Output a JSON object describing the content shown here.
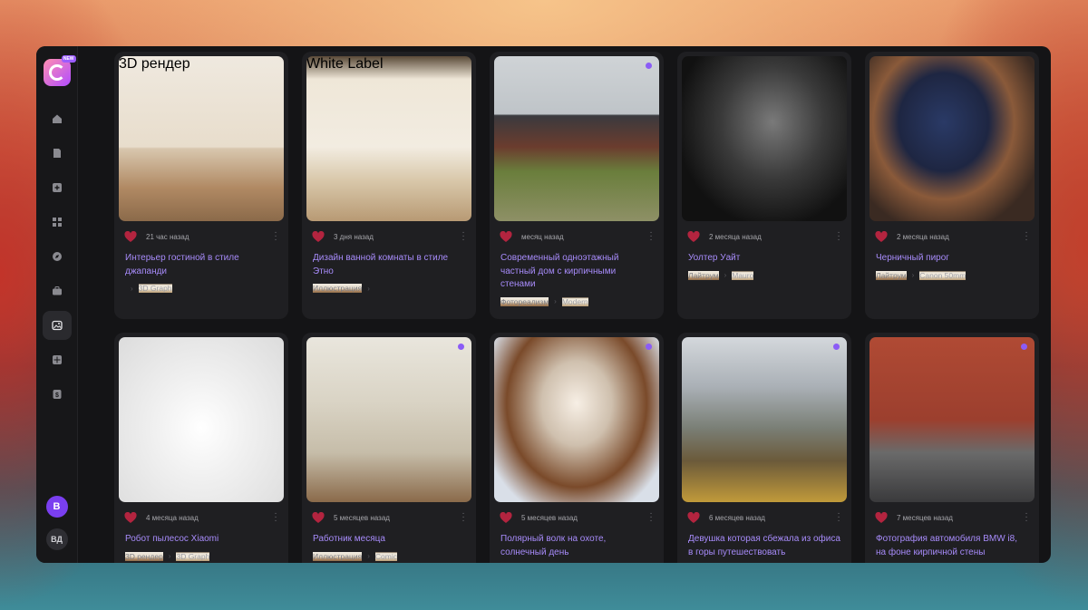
{
  "sidebar": {
    "logo_badge": "NEW",
    "nav": [
      {
        "icon": "home-icon",
        "active": false
      },
      {
        "icon": "document-icon",
        "active": false
      },
      {
        "icon": "plus-square-icon",
        "active": false
      },
      {
        "icon": "grid-icon",
        "active": false
      },
      {
        "icon": "compass-icon",
        "active": false
      },
      {
        "icon": "briefcase-icon",
        "active": false
      },
      {
        "icon": "image-gallery-icon",
        "active": true
      },
      {
        "icon": "apps-icon",
        "active": false
      },
      {
        "icon": "dollar-icon",
        "active": false
      }
    ],
    "avatar_primary": "B",
    "avatar_secondary": "ВД"
  },
  "cards": [
    {
      "time": "21 час назад",
      "title": "Интерьер гостиной в стиле джапанди",
      "tag1": "3D рендер",
      "tag2": "3D Graph",
      "dot": false
    },
    {
      "time": "3 дня назад",
      "title": "Дизайн ванной комнаты в стиле Этно",
      "tag1": "Иллюстрация",
      "tag2": "White Label",
      "dot": false
    },
    {
      "time": "месяц назад",
      "title": "Современный одноэтажный частный дом с кирпичными стенами",
      "tag1": "Фотореализм",
      "tag2": "Modern",
      "dot": true
    },
    {
      "time": "2 месяца назад",
      "title": "Уолтер Уайт",
      "tag1": "Лайтрум",
      "tag2": "Mauro",
      "dot": false
    },
    {
      "time": "2 месяца назад",
      "title": "Черничный пирог",
      "tag1": "Лайтрум",
      "tag2": "Canon 50mm",
      "dot": false
    },
    {
      "time": "4 месяца назад",
      "title": "Робот пылесос Xiaomi",
      "tag1": "3D рендер",
      "tag2": "3D Graph",
      "dot": false
    },
    {
      "time": "5 месяцев назад",
      "title": "Работник месяца",
      "tag1": "Иллюстрация",
      "tag2": "Comic",
      "dot": true
    },
    {
      "time": "5 месяцев назад",
      "title": "Полярный волк на охоте, солнечный день",
      "tag1": "",
      "tag2": "",
      "dot": true
    },
    {
      "time": "6 месяцев назад",
      "title": "Девушка которая сбежала из офиса в горы путешествовать",
      "tag1": "",
      "tag2": "",
      "dot": true
    },
    {
      "time": "7 месяцев назад",
      "title": "Фотография автомобиля BMW i8, на фоне кирпичной стены",
      "tag1": "",
      "tag2": "",
      "dot": true
    }
  ],
  "colors": {
    "accent": "#a78bfa",
    "dot": "#8b5cf6",
    "heart": "#c0264a"
  }
}
